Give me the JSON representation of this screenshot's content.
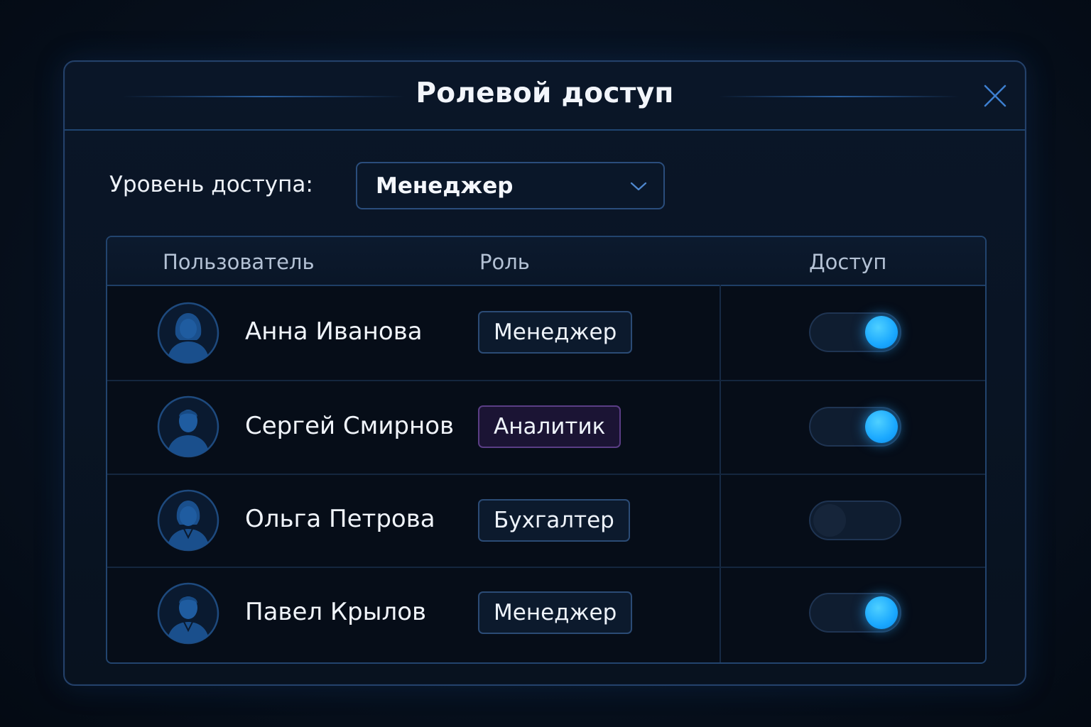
{
  "dialog": {
    "title": "Ролевой доступ"
  },
  "access_level": {
    "label": "Уровень доступа:",
    "selected": "Менеджер"
  },
  "table": {
    "headers": {
      "user": "Пользователь",
      "role": "Роль",
      "access": "Доступ"
    },
    "rows": [
      {
        "name": "Анна Иванова",
        "role": "Менеджер",
        "access": true
      },
      {
        "name": "Сергей Смирнов",
        "role": "Аналитик",
        "access": true
      },
      {
        "name": "Ольга Петрова",
        "role": "Бухгалтер",
        "access": false
      },
      {
        "name": "Павел Крылов",
        "role": "Менеджер",
        "access": true
      }
    ]
  },
  "colors": {
    "accent": "#1aa8ff",
    "border": "#24416a",
    "analyst_badge": "#5a3d85"
  },
  "icons": {
    "close": "close-icon",
    "dropdown": "chevron-down-icon",
    "avatar_female": "user-female-icon",
    "avatar_male": "user-male-icon"
  }
}
